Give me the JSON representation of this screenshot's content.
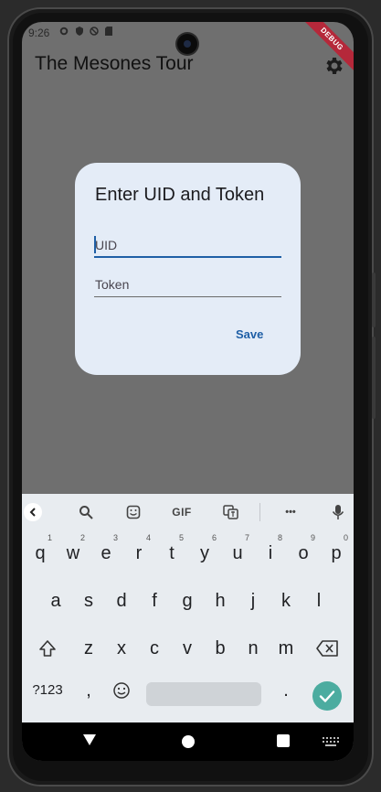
{
  "status_bar": {
    "time": "9:26"
  },
  "app_bar": {
    "title": "The Mesones Tour",
    "debug_banner": "DEBUG"
  },
  "dialog": {
    "title": "Enter UID and Token",
    "uid_label": "UID",
    "token_label": "Token",
    "save_label": "Save"
  },
  "keyboard": {
    "toolbar": {
      "gif_label": "GIF",
      "more_label": "•••"
    },
    "row1": [
      {
        "k": "q",
        "n": "1"
      },
      {
        "k": "w",
        "n": "2"
      },
      {
        "k": "e",
        "n": "3"
      },
      {
        "k": "r",
        "n": "4"
      },
      {
        "k": "t",
        "n": "5"
      },
      {
        "k": "y",
        "n": "6"
      },
      {
        "k": "u",
        "n": "7"
      },
      {
        "k": "i",
        "n": "8"
      },
      {
        "k": "o",
        "n": "9"
      },
      {
        "k": "p",
        "n": "0"
      }
    ],
    "row2": [
      "a",
      "s",
      "d",
      "f",
      "g",
      "h",
      "j",
      "k",
      "l"
    ],
    "row3": [
      "z",
      "x",
      "c",
      "v",
      "b",
      "n",
      "m"
    ],
    "symbols_label": "?123",
    "comma_label": ",",
    "period_label": "."
  }
}
